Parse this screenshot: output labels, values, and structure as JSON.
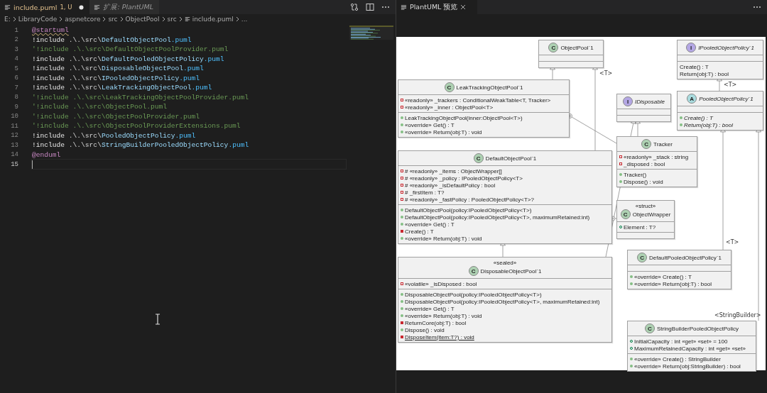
{
  "editor": {
    "tabs": [
      {
        "label": "include.puml",
        "badge": "1, U",
        "dirty": true,
        "preview": false,
        "selected": true
      },
      {
        "label": "扩展: PlantUML",
        "dirty": false,
        "preview": true,
        "selected": false
      }
    ],
    "breadcrumbs": [
      "E:",
      "LibraryCode",
      "aspnetcore",
      "src",
      "ObjectPool",
      "src",
      "include.puml",
      "..."
    ],
    "lines": [
      {
        "number": "1",
        "kind": "directive",
        "text": "@startuml",
        "warning": true,
        "current": false
      },
      {
        "number": "2",
        "kind": "include",
        "keyword": "!include",
        "path": ".\\.\\src\\",
        "file": "DefaultObjectPool",
        "ext": ".puml",
        "current": false
      },
      {
        "number": "3",
        "kind": "comment",
        "text": "'!include .\\.\\src\\DefaultObjectPoolProvider.puml",
        "current": false
      },
      {
        "number": "4",
        "kind": "include",
        "keyword": "!include",
        "path": ".\\.\\src\\",
        "file": "DefaultPooledObjectPolicy",
        "ext": ".puml",
        "current": false
      },
      {
        "number": "5",
        "kind": "include",
        "keyword": "!include",
        "path": ".\\.\\src\\",
        "file": "DisposableObjectPool",
        "ext": ".puml",
        "current": false
      },
      {
        "number": "6",
        "kind": "include",
        "keyword": "!include",
        "path": ".\\.\\src\\",
        "file": "IPooledObjectPolicy",
        "ext": ".puml",
        "current": false
      },
      {
        "number": "7",
        "kind": "include",
        "keyword": "!include",
        "path": ".\\.\\src\\",
        "file": "LeakTrackingObjectPool",
        "ext": ".puml",
        "current": false
      },
      {
        "number": "8",
        "kind": "comment",
        "text": "'!include .\\.\\src\\LeakTrackingObjectPoolProvider.puml",
        "current": false
      },
      {
        "number": "9",
        "kind": "comment",
        "text": "'!include .\\.\\src\\ObjectPool.puml",
        "current": false
      },
      {
        "number": "10",
        "kind": "comment",
        "text": "'!include .\\.\\src\\ObjectPoolProvider.puml",
        "current": false
      },
      {
        "number": "11",
        "kind": "comment",
        "text": "'!include .\\.\\src\\ObjectPoolProviderExtensions.puml",
        "current": false
      },
      {
        "number": "12",
        "kind": "include",
        "keyword": "!include",
        "path": ".\\.\\src\\",
        "file": "PooledObjectPolicy",
        "ext": ".puml",
        "current": false
      },
      {
        "number": "13",
        "kind": "include",
        "keyword": "!include",
        "path": ".\\.\\src\\",
        "file": "StringBuilderPooledObjectPolicy",
        "ext": ".puml",
        "current": false
      },
      {
        "number": "14",
        "kind": "directive",
        "text": "@enduml",
        "warning": false,
        "current": false
      },
      {
        "number": "15",
        "kind": "empty",
        "current": true
      }
    ]
  },
  "preview": {
    "tab": {
      "label": "PlantUML 预览",
      "selected": true
    },
    "classes": [
      {
        "kind": "class",
        "badge": "C",
        "name": "ObjectPool`1"
      },
      {
        "kind": "class",
        "badge": "C",
        "name": "LeakTrackingObjectPool`1",
        "fields": [
          {
            "kind": "private",
            "text": "«readonly» _trackers : ConditionalWeakTable<T, Tracker>"
          },
          {
            "kind": "private",
            "text": "«readonly» _inner : ObjectPool<T>"
          }
        ],
        "methods": [
          {
            "kind": "public",
            "text": "LeakTrackingObjectPool(inner:ObjectPool<T>)"
          },
          {
            "kind": "public",
            "text": "«override» Get() : T"
          },
          {
            "kind": "public",
            "text": "«override» Return(obj:T) : void"
          }
        ]
      },
      {
        "kind": "interface",
        "badge": "I",
        "name": "IDisposable"
      },
      {
        "kind": "class",
        "badge": "C",
        "name": "DefaultObjectPool`1",
        "fields": [
          {
            "kind": "private",
            "text": "# «readonly» _items : ObjectWrapper[]"
          },
          {
            "kind": "private",
            "text": "# «readonly» _policy : IPooledObjectPolicy<T>"
          },
          {
            "kind": "private",
            "text": "# «readonly» _isDefaultPolicy : bool"
          },
          {
            "kind": "private",
            "text": "# _firstItem : T?"
          },
          {
            "kind": "private",
            "text": "# «readonly» _fastPolicy : PooledObjectPolicy<T>?"
          }
        ],
        "methods": [
          {
            "kind": "public",
            "text": "DefaultObjectPool(policy:IPooledObjectPolicy<T>)"
          },
          {
            "kind": "public",
            "text": "DefaultObjectPool(policy:IPooledObjectPolicy<T>, maximumRetained:int)"
          },
          {
            "kind": "public",
            "text": "«override» Get() : T"
          },
          {
            "kind": "private",
            "text": "Create() : T"
          },
          {
            "kind": "public",
            "text": "«override» Return(obj:T) : void"
          }
        ]
      },
      {
        "kind": "class",
        "badge": "C",
        "name": "Tracker",
        "fields": [
          {
            "kind": "private",
            "text": "«readonly» _stack : string"
          },
          {
            "kind": "private",
            "text": "_disposed : bool"
          }
        ],
        "methods": [
          {
            "kind": "public",
            "text": "Tracker()"
          },
          {
            "kind": "public",
            "text": "Dispose() : void"
          }
        ]
      },
      {
        "kind": "class",
        "badge": "C",
        "stereotype": "«sealed»",
        "name": "DisposableObjectPool`1",
        "fields": [
          {
            "kind": "private",
            "text": "«volatile» _isDisposed : bool"
          }
        ],
        "methods": [
          {
            "kind": "public",
            "text": "DisposableObjectPool(policy:IPooledObjectPolicy<T>)"
          },
          {
            "kind": "public",
            "text": "DisposableObjectPool(policy:IPooledObjectPolicy<T>, maximumRetained:int)"
          },
          {
            "kind": "public",
            "text": "«override» Get() : T"
          },
          {
            "kind": "public",
            "text": "«override» Return(obj:T) : void"
          },
          {
            "kind": "private",
            "text": "ReturnCore(obj:T) : bool"
          },
          {
            "kind": "public",
            "text": "Dispose() : void"
          },
          {
            "kind": "private-static",
            "text": "DisposeItem(item:T?) : void"
          }
        ]
      },
      {
        "kind": "class",
        "badge": "C",
        "stereotype": "«struct»",
        "name": "ObjectWrapper",
        "fields": [
          {
            "kind": "public",
            "text": "Element : T?"
          }
        ]
      },
      {
        "kind": "interface",
        "badge": "I",
        "name": "IPooledObjectPolicy`1",
        "methods": [
          {
            "kind": "plain",
            "text": "Create() : T"
          },
          {
            "kind": "plain",
            "text": "Return(obj:T) : bool"
          }
        ]
      },
      {
        "kind": "abstract",
        "badge": "A",
        "name": "PooledObjectPolicy`1",
        "methods": [
          {
            "kind": "public-abstract",
            "text": "Create() : T"
          },
          {
            "kind": "public-abstract",
            "text": "Return(obj:T) : bool"
          }
        ]
      },
      {
        "kind": "class",
        "badge": "C",
        "name": "DefaultPooledObjectPolicy`1",
        "methods": [
          {
            "kind": "public",
            "text": "«override» Create() : T"
          },
          {
            "kind": "public",
            "text": "«override» Return(obj:T) : bool"
          }
        ]
      },
      {
        "kind": "class",
        "badge": "C",
        "name": "StringBuilderPooledObjectPolicy",
        "fields": [
          {
            "kind": "public",
            "text": "InitialCapacity : int «get» «set» = 100"
          },
          {
            "kind": "public",
            "text": "MaximumRetainedCapacity : int «get» «set»"
          }
        ],
        "methods": [
          {
            "kind": "public",
            "text": "«override» Create() : StringBuilder"
          },
          {
            "kind": "public",
            "text": "«override» Return(obj:StringBuilder) : bool"
          }
        ]
      }
    ],
    "relations": [
      {
        "kind": "inherit"
      },
      {
        "kind": "inherit",
        "label": "<T>"
      },
      {
        "kind": "inherit"
      },
      {
        "kind": "inherit"
      },
      {
        "kind": "nest"
      },
      {
        "kind": "inherit"
      },
      {
        "kind": "nest"
      },
      {
        "kind": "inherit",
        "label": "<T>"
      },
      {
        "kind": "inherit",
        "label": "<T>"
      },
      {
        "kind": "inherit",
        "label": "<StringBuilder>"
      }
    ]
  }
}
